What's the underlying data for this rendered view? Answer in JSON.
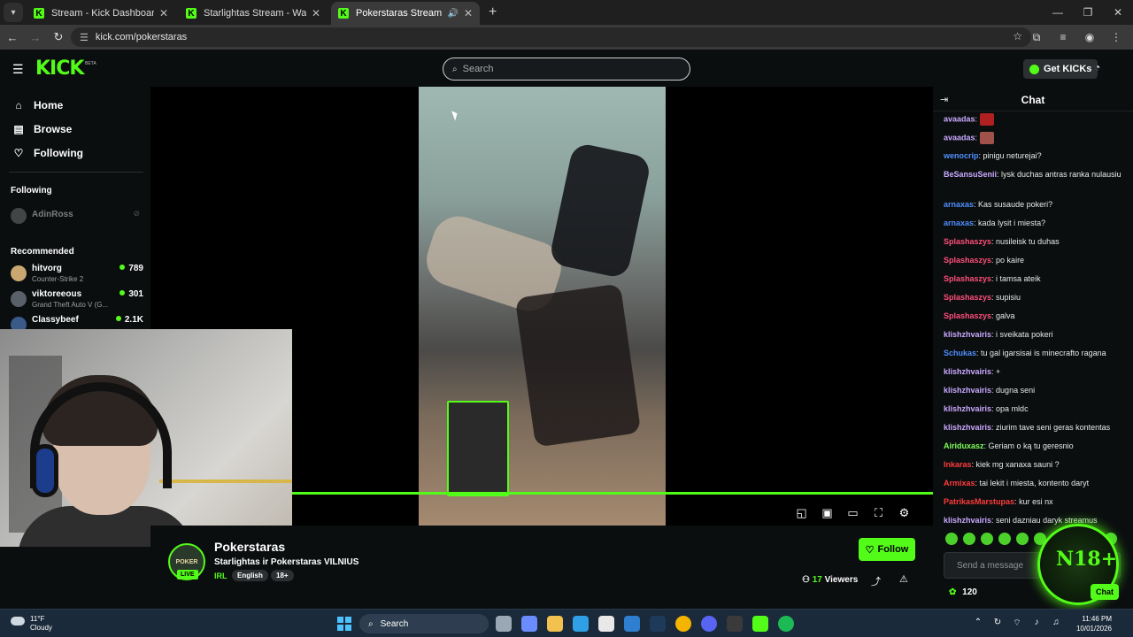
{
  "browser": {
    "tabs": [
      {
        "title": "Stream - Kick Dashboard",
        "active": false
      },
      {
        "title": "Starlightas Stream - Watch Live",
        "active": false
      },
      {
        "title": "Pokerstaras Stream - Watch",
        "active": true
      }
    ],
    "url": "kick.com/pokerstaras"
  },
  "header": {
    "logo": "KICK",
    "beta": "BETA",
    "search_placeholder": "Search",
    "get_kicks": "Get KICKs"
  },
  "sidebar": {
    "nav": [
      {
        "label": "Home",
        "icon": "home-icon"
      },
      {
        "label": "Browse",
        "icon": "browse-icon"
      },
      {
        "label": "Following",
        "icon": "heart-icon"
      }
    ],
    "following_header": "Following",
    "following": [
      {
        "name": "AdinRoss"
      }
    ],
    "recommended_header": "Recommended",
    "recommended": [
      {
        "name": "hitvorg",
        "category": "Counter-Strike 2",
        "viewers": "789"
      },
      {
        "name": "viktoreeous",
        "category": "Grand Theft Auto V (G...",
        "viewers": "301"
      },
      {
        "name": "Classybeef",
        "category": "",
        "viewers": "2.1K"
      }
    ]
  },
  "stream": {
    "channel": "Pokerstaras",
    "title": "Starlightas ir Pokerstaras VILNIUS",
    "category": "IRL",
    "tags": [
      "English",
      "18+"
    ],
    "follow_label": "Follow",
    "viewers_count": "17",
    "viewers_label": "Viewers",
    "avatar_text": "POKER",
    "live_label": "LIVE"
  },
  "chat": {
    "title": "Chat",
    "messages": [
      {
        "user": "avaadas",
        "text": "",
        "color": "#c9a8ff",
        "emote": "#b02020"
      },
      {
        "user": "avaadas",
        "text": "",
        "color": "#c9a8ff",
        "emote": "#a0524a"
      },
      {
        "user": "wenocrip",
        "text": "pinigu neturejai?",
        "color": "#4f8fff"
      },
      {
        "user": "BeSansuSenii",
        "text": "lysk duchas antras ranka nulausiu",
        "color": "#c9a8ff"
      },
      {
        "user": "arnaxas",
        "text": "Kas susaude pokeri?",
        "color": "#4f8fff"
      },
      {
        "user": "arnaxas",
        "text": "kada lysit i miesta?",
        "color": "#4f8fff"
      },
      {
        "user": "Splashaszys",
        "text": "nusileisk tu duhas",
        "color": "#ff4f7a"
      },
      {
        "user": "Splashaszys",
        "text": "po kaire",
        "color": "#ff4f7a"
      },
      {
        "user": "Splashaszys",
        "text": "i tamsa ateik",
        "color": "#ff4f7a"
      },
      {
        "user": "Splashaszys",
        "text": "supisiu",
        "color": "#ff4f7a"
      },
      {
        "user": "Splashaszys",
        "text": "galva",
        "color": "#ff4f7a"
      },
      {
        "user": "klishzhvairis",
        "text": "i sveikata pokeri",
        "color": "#c9a8ff"
      },
      {
        "user": "Schukas",
        "text": "tu gal igarsisai is minecrafto ragana",
        "color": "#4f8fff"
      },
      {
        "user": "klishzhvairis",
        "text": "+",
        "color": "#c9a8ff"
      },
      {
        "user": "klishzhvairis",
        "text": "dugna seni",
        "color": "#c9a8ff"
      },
      {
        "user": "klishzhvairis",
        "text": "opa mldc",
        "color": "#c9a8ff"
      },
      {
        "user": "klishzhvairis",
        "text": "ziurim tave seni geras kontentas",
        "color": "#c9a8ff"
      },
      {
        "user": "Airiduxasz",
        "text": "Geriam o ką tu geresnio",
        "color": "#7dff5a"
      },
      {
        "user": "Inkaras",
        "text": "kiek mg xanaxa sauni ?",
        "color": "#ff3b3b"
      },
      {
        "user": "Armixas",
        "text": "tai lekit i miesta, kontento daryt",
        "color": "#ff3b3b"
      },
      {
        "user": "PatrikasMarstupas",
        "text": "kur esi nx",
        "color": "#ff3b3b"
      },
      {
        "user": "klishzhvairis",
        "text": "seni dazniau daryk streamus",
        "color": "#c9a8ff"
      }
    ],
    "send_placeholder": "Send a message",
    "points": "120",
    "overlay_badge": "N18+",
    "chat_button": "Chat"
  },
  "taskbar": {
    "temp": "11°F",
    "condition": "Cloudy",
    "search": "Search",
    "time": "11:46 PM",
    "date": "10/01/2026"
  },
  "colors": {
    "accent": "#53fc18",
    "background": "#0b0e0f"
  }
}
